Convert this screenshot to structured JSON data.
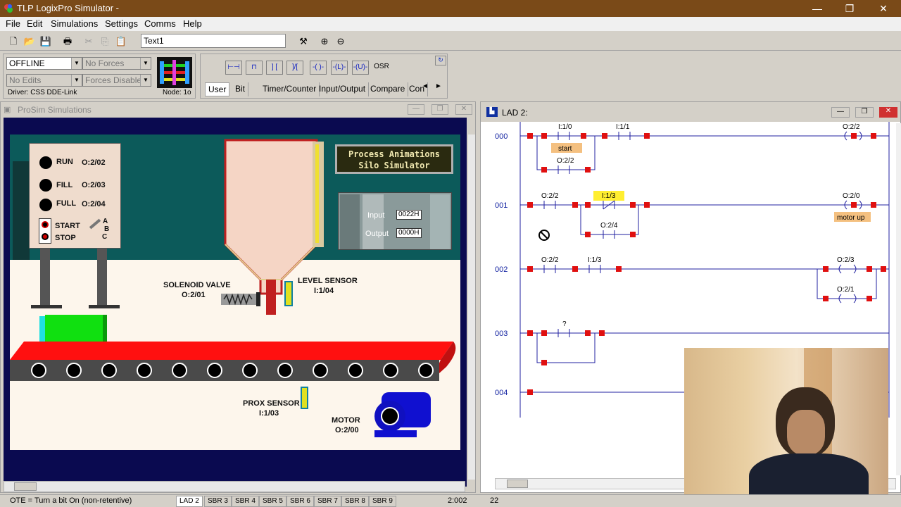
{
  "app": {
    "title": "TLP LogixPro Simulator  -",
    "window_controls": [
      "—",
      "❐",
      "✕"
    ]
  },
  "menu": [
    "File",
    "Edit",
    "Simulations",
    "Settings",
    "Comms",
    "Help"
  ],
  "toolbar": {
    "tag_field_value": "Text1"
  },
  "status_panel": {
    "mode": "OFFLINE",
    "forces": "No Forces",
    "edits": "No Edits",
    "forces_state": "Forces Disabled",
    "driver": "Driver: CSS DDE-Link",
    "node": "Node: 1o"
  },
  "palette": {
    "buttons": [
      "⊢⊣",
      "⊓",
      "] [",
      "]/[",
      "-( )-",
      "-(L)-",
      "-(U)-",
      "OSR"
    ],
    "tabs": [
      "User",
      "Bit",
      "Timer/Counter",
      "Input/Output",
      "Compare",
      "Con"
    ],
    "scroll": [
      "◄",
      "►"
    ]
  },
  "prosim": {
    "title": "ProSim Simulations",
    "banner_line1": "Process Animations",
    "banner_line2": "Silo Simulator",
    "indicators": [
      {
        "label": "RUN",
        "addr": "O:2/02"
      },
      {
        "label": "FILL",
        "addr": "O:2/03"
      },
      {
        "label": "FULL",
        "addr": "O:2/04"
      }
    ],
    "start_label": "START",
    "stop_label": "STOP",
    "abc": [
      "A",
      "B",
      "C"
    ],
    "plc_input_label": "Input",
    "plc_output_label": "Output",
    "plc_input_value": "0022H",
    "plc_output_value": "0000H",
    "solenoid_label": "SOLENOID VALVE",
    "solenoid_addr": "O:2/01",
    "level_label": "LEVEL SENSOR",
    "level_addr": "I:1/04",
    "prox_label": "PROX SENSOR",
    "prox_addr": "I:1/03",
    "motor_label": "MOTOR",
    "motor_addr": "O:2/00",
    "colors": {
      "belt": "#ff1010",
      "box": "#10e010",
      "wall": "#0c5a5a",
      "silo": "#f5d5c5"
    }
  },
  "lad": {
    "title": "LAD 2:",
    "rungs": [
      {
        "number": "000",
        "contacts": [
          {
            "addr": "I:1/0",
            "desc": "start"
          },
          {
            "addr": "I:1/1",
            "desc": ""
          }
        ],
        "branch_contact": {
          "addr": "O:2/2"
        },
        "coil": {
          "addr": "O:2/2",
          "desc": ""
        }
      },
      {
        "number": "001",
        "contacts": [
          {
            "addr": "O:2/2",
            "desc": ""
          },
          {
            "addr": "I:1/3",
            "desc": ""
          }
        ],
        "branch_contact": {
          "addr": "O:2/4"
        },
        "coil": {
          "addr": "O:2/0",
          "desc": "motor up"
        }
      },
      {
        "number": "002",
        "contacts": [
          {
            "addr": "O:2/2",
            "desc": ""
          },
          {
            "addr": "I:1/3",
            "desc": ""
          }
        ],
        "coil": {
          "addr": "O:2/3"
        },
        "coil2": {
          "addr": "O:2/1"
        }
      },
      {
        "number": "003",
        "contacts": [
          {
            "addr": "?",
            "desc": ""
          }
        ]
      },
      {
        "number": "004"
      }
    ]
  },
  "statusbar": {
    "hint": "OTE = Turn a bit On (non-retentive)",
    "tabs": [
      "LAD 2",
      "SBR 3",
      "SBR 4",
      "SBR 5",
      "SBR 6",
      "SBR 7",
      "SBR 8",
      "SBR 9"
    ],
    "position": "2:002",
    "count": "22"
  }
}
